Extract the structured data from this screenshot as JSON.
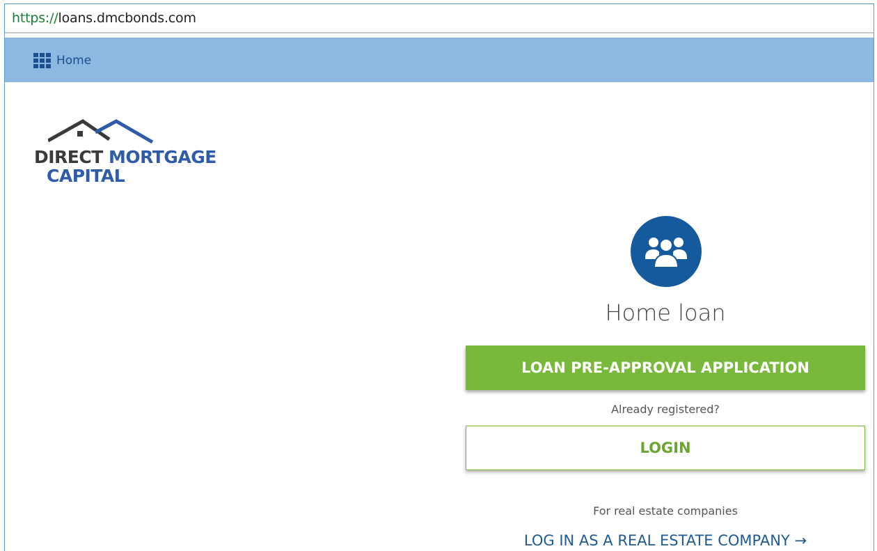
{
  "browser": {
    "url_scheme": "https://",
    "url_host": "loans.dmcbonds.com"
  },
  "nav": {
    "home_label": "Home",
    "home_icon": "grid-icon"
  },
  "logo": {
    "word1": "DIRECT",
    "word2": "MORTGAGE",
    "word3": "CAPITAL",
    "icon": "house-roof-icon"
  },
  "panel": {
    "icon": "users-group-icon",
    "title": "Home loan",
    "primary_button": "LOAN PRE-APPROVAL APPLICATION",
    "already_registered": "Already registered?",
    "login_button": "LOGIN",
    "real_estate_caption": "For real estate companies",
    "real_estate_link": "LOG IN AS A REAL ESTATE COMPANY →"
  },
  "colors": {
    "nav_bg": "#8db8e2",
    "brand_blue": "#155a9c",
    "accent_green": "#78b83a",
    "link_blue": "#1d5a96"
  }
}
